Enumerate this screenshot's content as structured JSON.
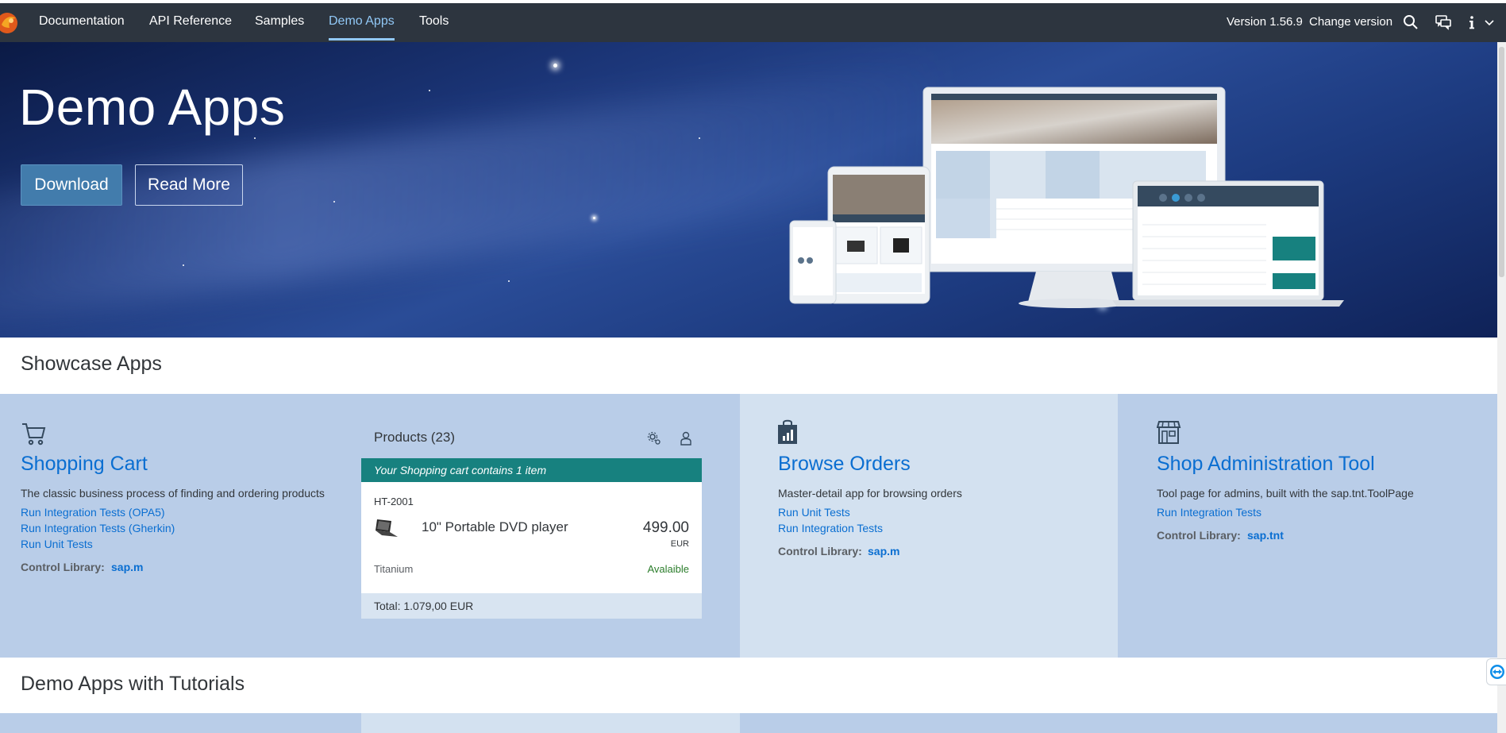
{
  "nav": {
    "items": [
      {
        "label": "Documentation",
        "active": false
      },
      {
        "label": "API Reference",
        "active": false
      },
      {
        "label": "Samples",
        "active": false
      },
      {
        "label": "Demo Apps",
        "active": true
      },
      {
        "label": "Tools",
        "active": false
      }
    ],
    "version": "Version 1.56.9",
    "change_version": "Change version",
    "icons": [
      "search-icon",
      "feedback-icon",
      "info-icon",
      "chevron-down-icon"
    ]
  },
  "hero": {
    "title": "Demo Apps",
    "download_label": "Download",
    "read_more_label": "Read More"
  },
  "showcase": {
    "title": "Showcase Apps",
    "shopping_cart": {
      "icon": "cart-icon",
      "title": "Shopping Cart",
      "description": "The classic business process of finding and ordering products",
      "links": [
        "Run Integration Tests (OPA5)",
        "Run Integration Tests (Gherkin)",
        "Run Unit Tests"
      ],
      "control_label": "Control Library:",
      "control_value": "sap.m"
    },
    "product_card": {
      "header": "Products (23)",
      "banner": "Your Shopping cart contains 1 item",
      "product_id": "HT-2001",
      "product_name": "10\" Portable DVD player",
      "price": "499.00",
      "currency": "EUR",
      "material": "Titanium",
      "status": "Avalaible",
      "total": "Total: 1.079,00 EUR"
    },
    "browse_orders": {
      "icon": "shopping-bag-icon",
      "title": "Browse Orders",
      "description": "Master-detail app for browsing orders",
      "links": [
        "Run Unit Tests",
        "Run Integration Tests"
      ],
      "control_label": "Control Library:",
      "control_value": "sap.m"
    },
    "shop_admin": {
      "icon": "store-icon",
      "title": "Shop Administration Tool",
      "description": "Tool page for admins, built with the sap.tnt.ToolPage",
      "links": [
        "Run Integration Tests"
      ],
      "control_label": "Control Library:",
      "control_value": "sap.tnt"
    }
  },
  "tutorials": {
    "title": "Demo Apps with Tutorials"
  },
  "colors": {
    "shell": "#2d353f",
    "accent": "#0a6ed1",
    "nav_active": "#91c8f6",
    "banner": "#17817f",
    "status_ok": "#2b7d2b"
  }
}
